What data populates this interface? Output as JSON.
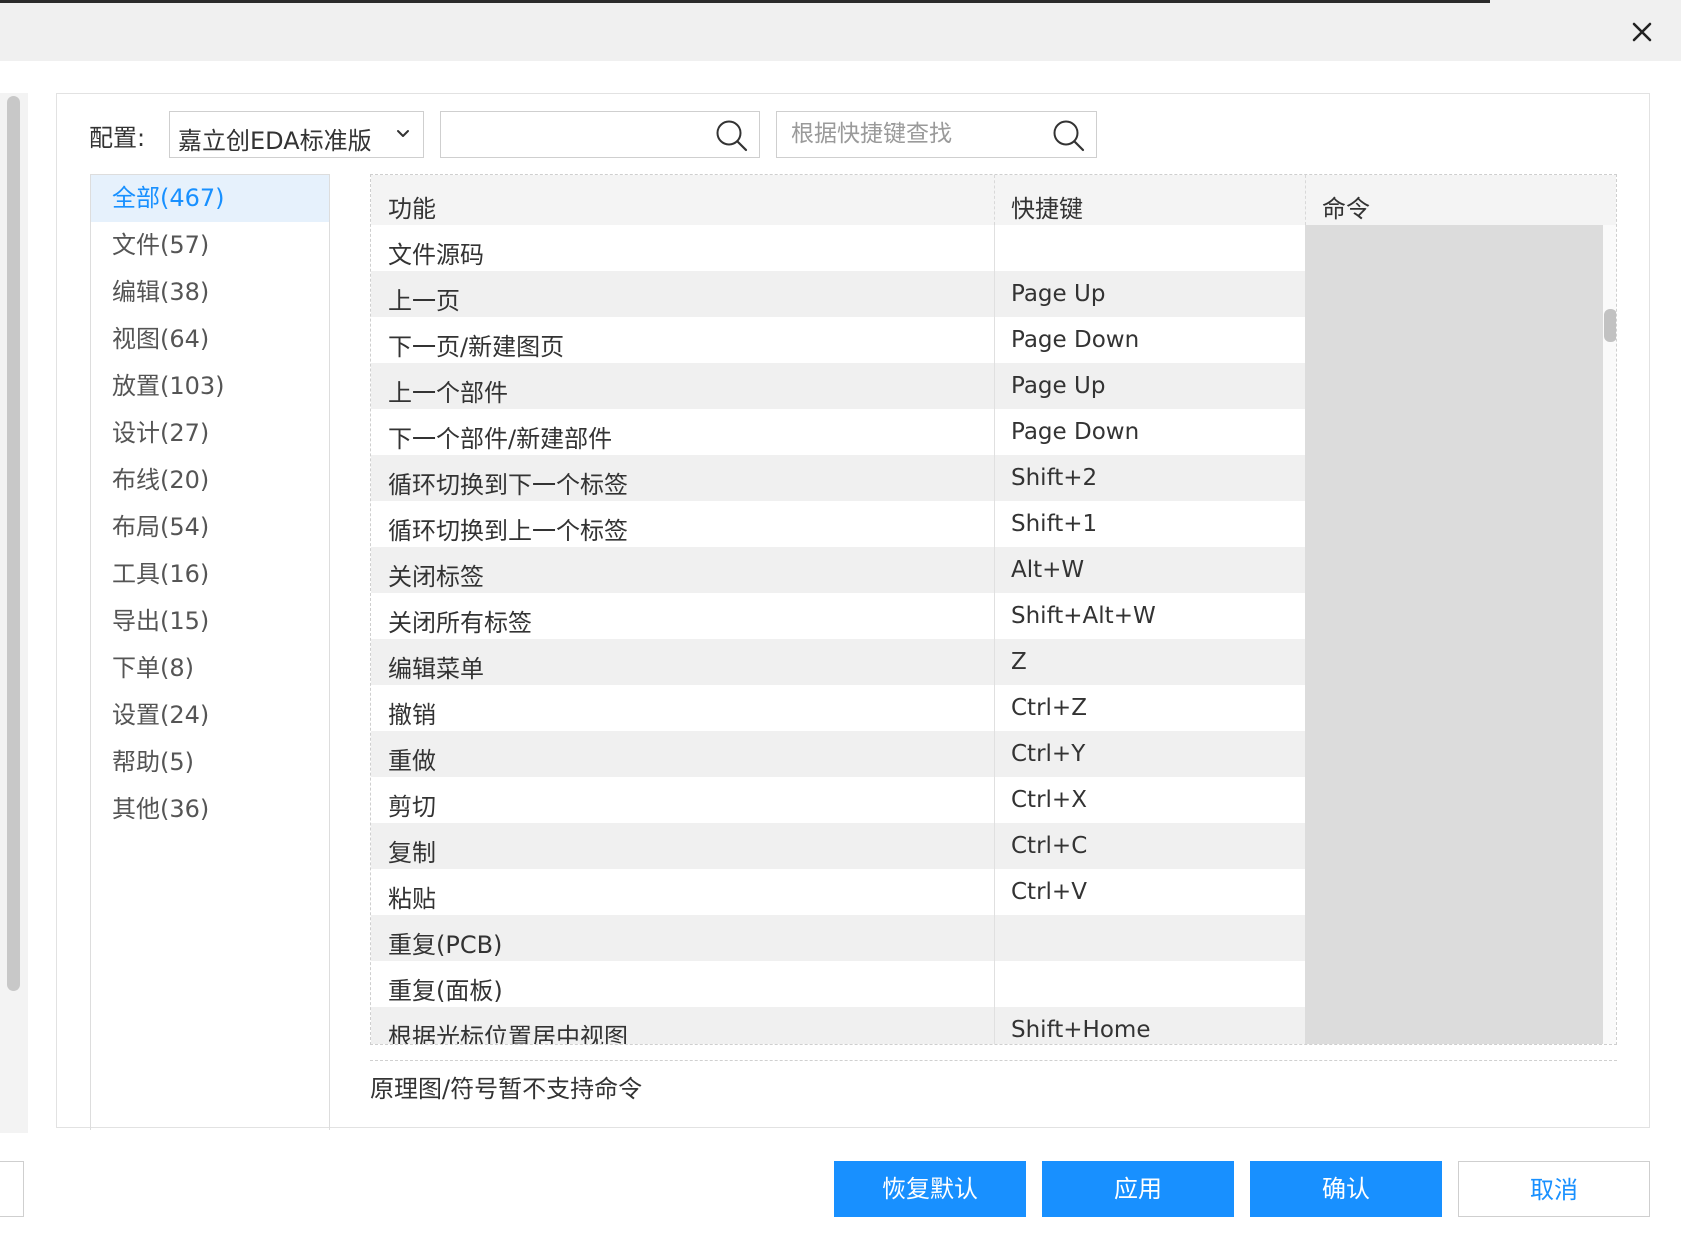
{
  "dialog": {
    "close_label": "×"
  },
  "config": {
    "label": "配置:",
    "selected": "嘉立创EDA标准版",
    "search_placeholder": "",
    "shortcut_search_placeholder": "根据快捷键查找"
  },
  "categories": [
    {
      "label": "全部(467)",
      "active": true
    },
    {
      "label": "文件(57)"
    },
    {
      "label": "编辑(38)"
    },
    {
      "label": "视图(64)"
    },
    {
      "label": "放置(103)"
    },
    {
      "label": "设计(27)"
    },
    {
      "label": "布线(20)"
    },
    {
      "label": "布局(54)"
    },
    {
      "label": "工具(16)"
    },
    {
      "label": "导出(15)"
    },
    {
      "label": "下单(8)"
    },
    {
      "label": "设置(24)"
    },
    {
      "label": "帮助(5)"
    },
    {
      "label": "其他(36)"
    }
  ],
  "table": {
    "headers": {
      "function": "功能",
      "shortcut": "快捷键",
      "command": "命令"
    },
    "rows": [
      {
        "function": "文件源码",
        "shortcut": ""
      },
      {
        "function": "上一页",
        "shortcut": "Page Up"
      },
      {
        "function": "下一页/新建图页",
        "shortcut": "Page Down"
      },
      {
        "function": "上一个部件",
        "shortcut": "Page Up"
      },
      {
        "function": "下一个部件/新建部件",
        "shortcut": "Page Down"
      },
      {
        "function": "循环切换到下一个标签",
        "shortcut": "Shift+2"
      },
      {
        "function": "循环切换到上一个标签",
        "shortcut": "Shift+1"
      },
      {
        "function": "关闭标签",
        "shortcut": "Alt+W"
      },
      {
        "function": "关闭所有标签",
        "shortcut": "Shift+Alt+W"
      },
      {
        "function": "编辑菜单",
        "shortcut": "Z"
      },
      {
        "function": "撤销",
        "shortcut": "Ctrl+Z"
      },
      {
        "function": "重做",
        "shortcut": "Ctrl+Y"
      },
      {
        "function": "剪切",
        "shortcut": "Ctrl+X"
      },
      {
        "function": "复制",
        "shortcut": "Ctrl+C"
      },
      {
        "function": "粘贴",
        "shortcut": "Ctrl+V"
      },
      {
        "function": "重复(PCB)",
        "shortcut": ""
      },
      {
        "function": "重复(面板)",
        "shortcut": ""
      },
      {
        "function": "根据光标位置居中视图",
        "shortcut": "Shift+Home"
      }
    ]
  },
  "note": "原理图/符号暂不支持命令",
  "buttons": {
    "restore": "恢复默认",
    "apply": "应用",
    "confirm": "确认",
    "cancel": "取消"
  },
  "colors": {
    "accent": "#1890ff",
    "active_bg": "#e6f1fc",
    "command_bg": "#dcdcdc"
  },
  "icons": {
    "close": "close-icon",
    "search": "search-icon",
    "dropdown": "chevron-down-icon"
  }
}
